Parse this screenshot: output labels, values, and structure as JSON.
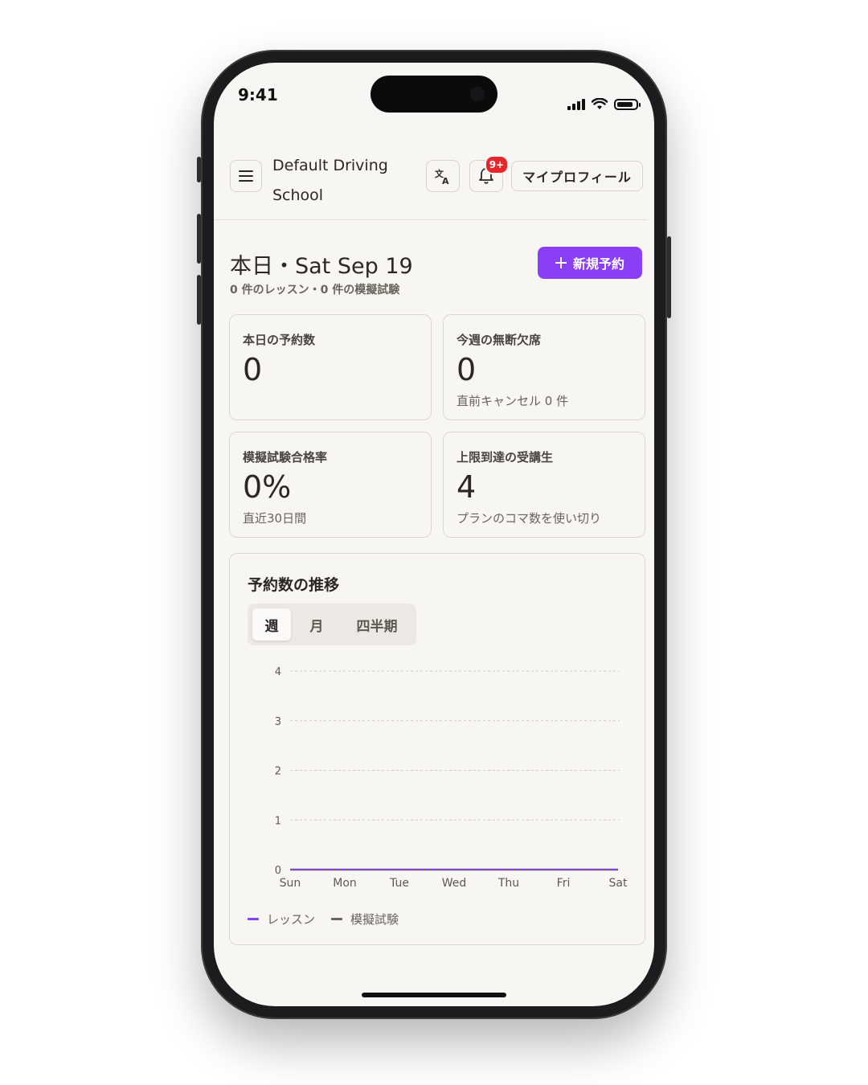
{
  "status_bar": {
    "time": "9:41"
  },
  "header": {
    "brand_line1": "Default Driving",
    "brand_line2": "School",
    "notification_badge": "9+",
    "profile_label": "マイプロフィール",
    "icons": {
      "menu": "hamburger-menu-icon",
      "translate": "translate-icon",
      "bell": "bell-icon"
    }
  },
  "today": {
    "title": "本日・Sat Sep 19",
    "subtitle": "0 件のレッスン・0 件の模擬試験",
    "new_booking_label": "新規予約",
    "accent_color": "#8b3ff5"
  },
  "stats": [
    {
      "label": "本日の予約数",
      "value": "0",
      "note": ""
    },
    {
      "label": "今週の無断欠席",
      "value": "0",
      "note": "直前キャンセル 0 件"
    },
    {
      "label": "模擬試験合格率",
      "value": "0%",
      "note": "直近30日間"
    },
    {
      "label": "上限到達の受講生",
      "value": "4",
      "note": "プランのコマ数を使い切り"
    }
  ],
  "chart_section": {
    "title": "予約数の推移",
    "tabs": [
      {
        "label": "週",
        "active": true
      },
      {
        "label": "月",
        "active": false
      },
      {
        "label": "四半期",
        "active": false
      }
    ]
  },
  "chart_data": {
    "type": "line",
    "x": [
      "Sun",
      "Mon",
      "Tue",
      "Wed",
      "Thu",
      "Fri",
      "Sat"
    ],
    "series": [
      {
        "name": "レッスン",
        "values": [
          0,
          0,
          0,
          0,
          0,
          0,
          0
        ],
        "color": "#8b3ff5"
      },
      {
        "name": "模擬試験",
        "values": [
          0,
          0,
          0,
          0,
          0,
          0,
          0
        ],
        "color": "#6b6560"
      }
    ],
    "yticks": [
      0,
      1,
      2,
      3,
      4
    ],
    "ylim": [
      0,
      4
    ],
    "grid": true,
    "legend": "bottom-left"
  }
}
